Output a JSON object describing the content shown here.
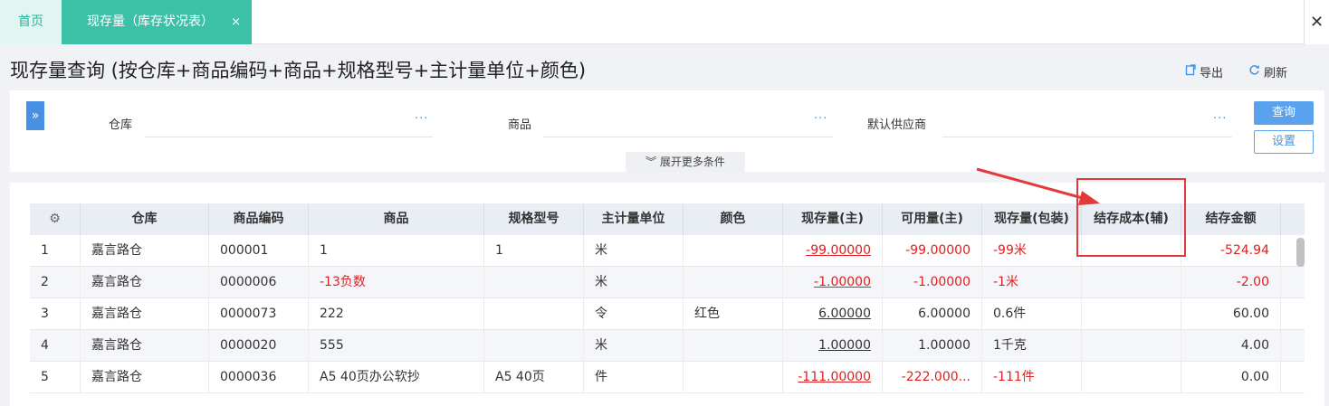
{
  "tabs": {
    "home": "首页",
    "active": "现存量（库存状况表）",
    "close_glyph": "×"
  },
  "window": {
    "close_glyph": "✕"
  },
  "page": {
    "title": "现存量查询 (按仓库+商品编码+商品+规格型号+主计量单位+颜色)",
    "export_label": "导出",
    "refresh_label": "刷新"
  },
  "filters": {
    "toggle_glyph": "»",
    "warehouse_label": "仓库",
    "product_label": "商品",
    "supplier_label": "默认供应商",
    "dots": "···",
    "query_label": "查询",
    "settings_label": "设置",
    "more_label": "展开更多条件",
    "more_glyph": "︾"
  },
  "grid": {
    "gear_icon": "⚙",
    "headers": [
      "仓库",
      "商品编码",
      "商品",
      "规格型号",
      "主计量单位",
      "颜色",
      "现存量(主)",
      "可用量(主)",
      "现存量(包装)",
      "结存成本(辅)",
      "结存金额"
    ],
    "rows": [
      [
        "1",
        "嘉言路仓",
        "000001",
        "1",
        "1",
        "米",
        "",
        "-99.00000",
        "-99.00000",
        "-99米",
        "",
        "-524.94"
      ],
      [
        "2",
        "嘉言路仓",
        "0000006",
        "-13负数",
        "",
        "米",
        "",
        "-1.00000",
        "-1.00000",
        "-1米",
        "",
        "-2.00"
      ],
      [
        "3",
        "嘉言路仓",
        "0000073",
        "222",
        "",
        "令",
        "红色",
        "6.00000",
        "6.00000",
        "0.6件",
        "",
        "60.00"
      ],
      [
        "4",
        "嘉言路仓",
        "0000020",
        "555",
        "",
        "米",
        "",
        "1.00000",
        "1.00000",
        "1千克",
        "",
        "4.00"
      ],
      [
        "5",
        "嘉言路仓",
        "0000036",
        "A5 40页办公软抄",
        "A5 40页",
        "件",
        "",
        "-111.00000",
        "-222.000...",
        "-111件",
        "",
        "0.00"
      ]
    ]
  },
  "colors": {
    "accent_green": "#3cc1a8",
    "accent_blue": "#4a90e2",
    "negative_red": "#e02020",
    "annotation_red": "#e23a3a"
  }
}
